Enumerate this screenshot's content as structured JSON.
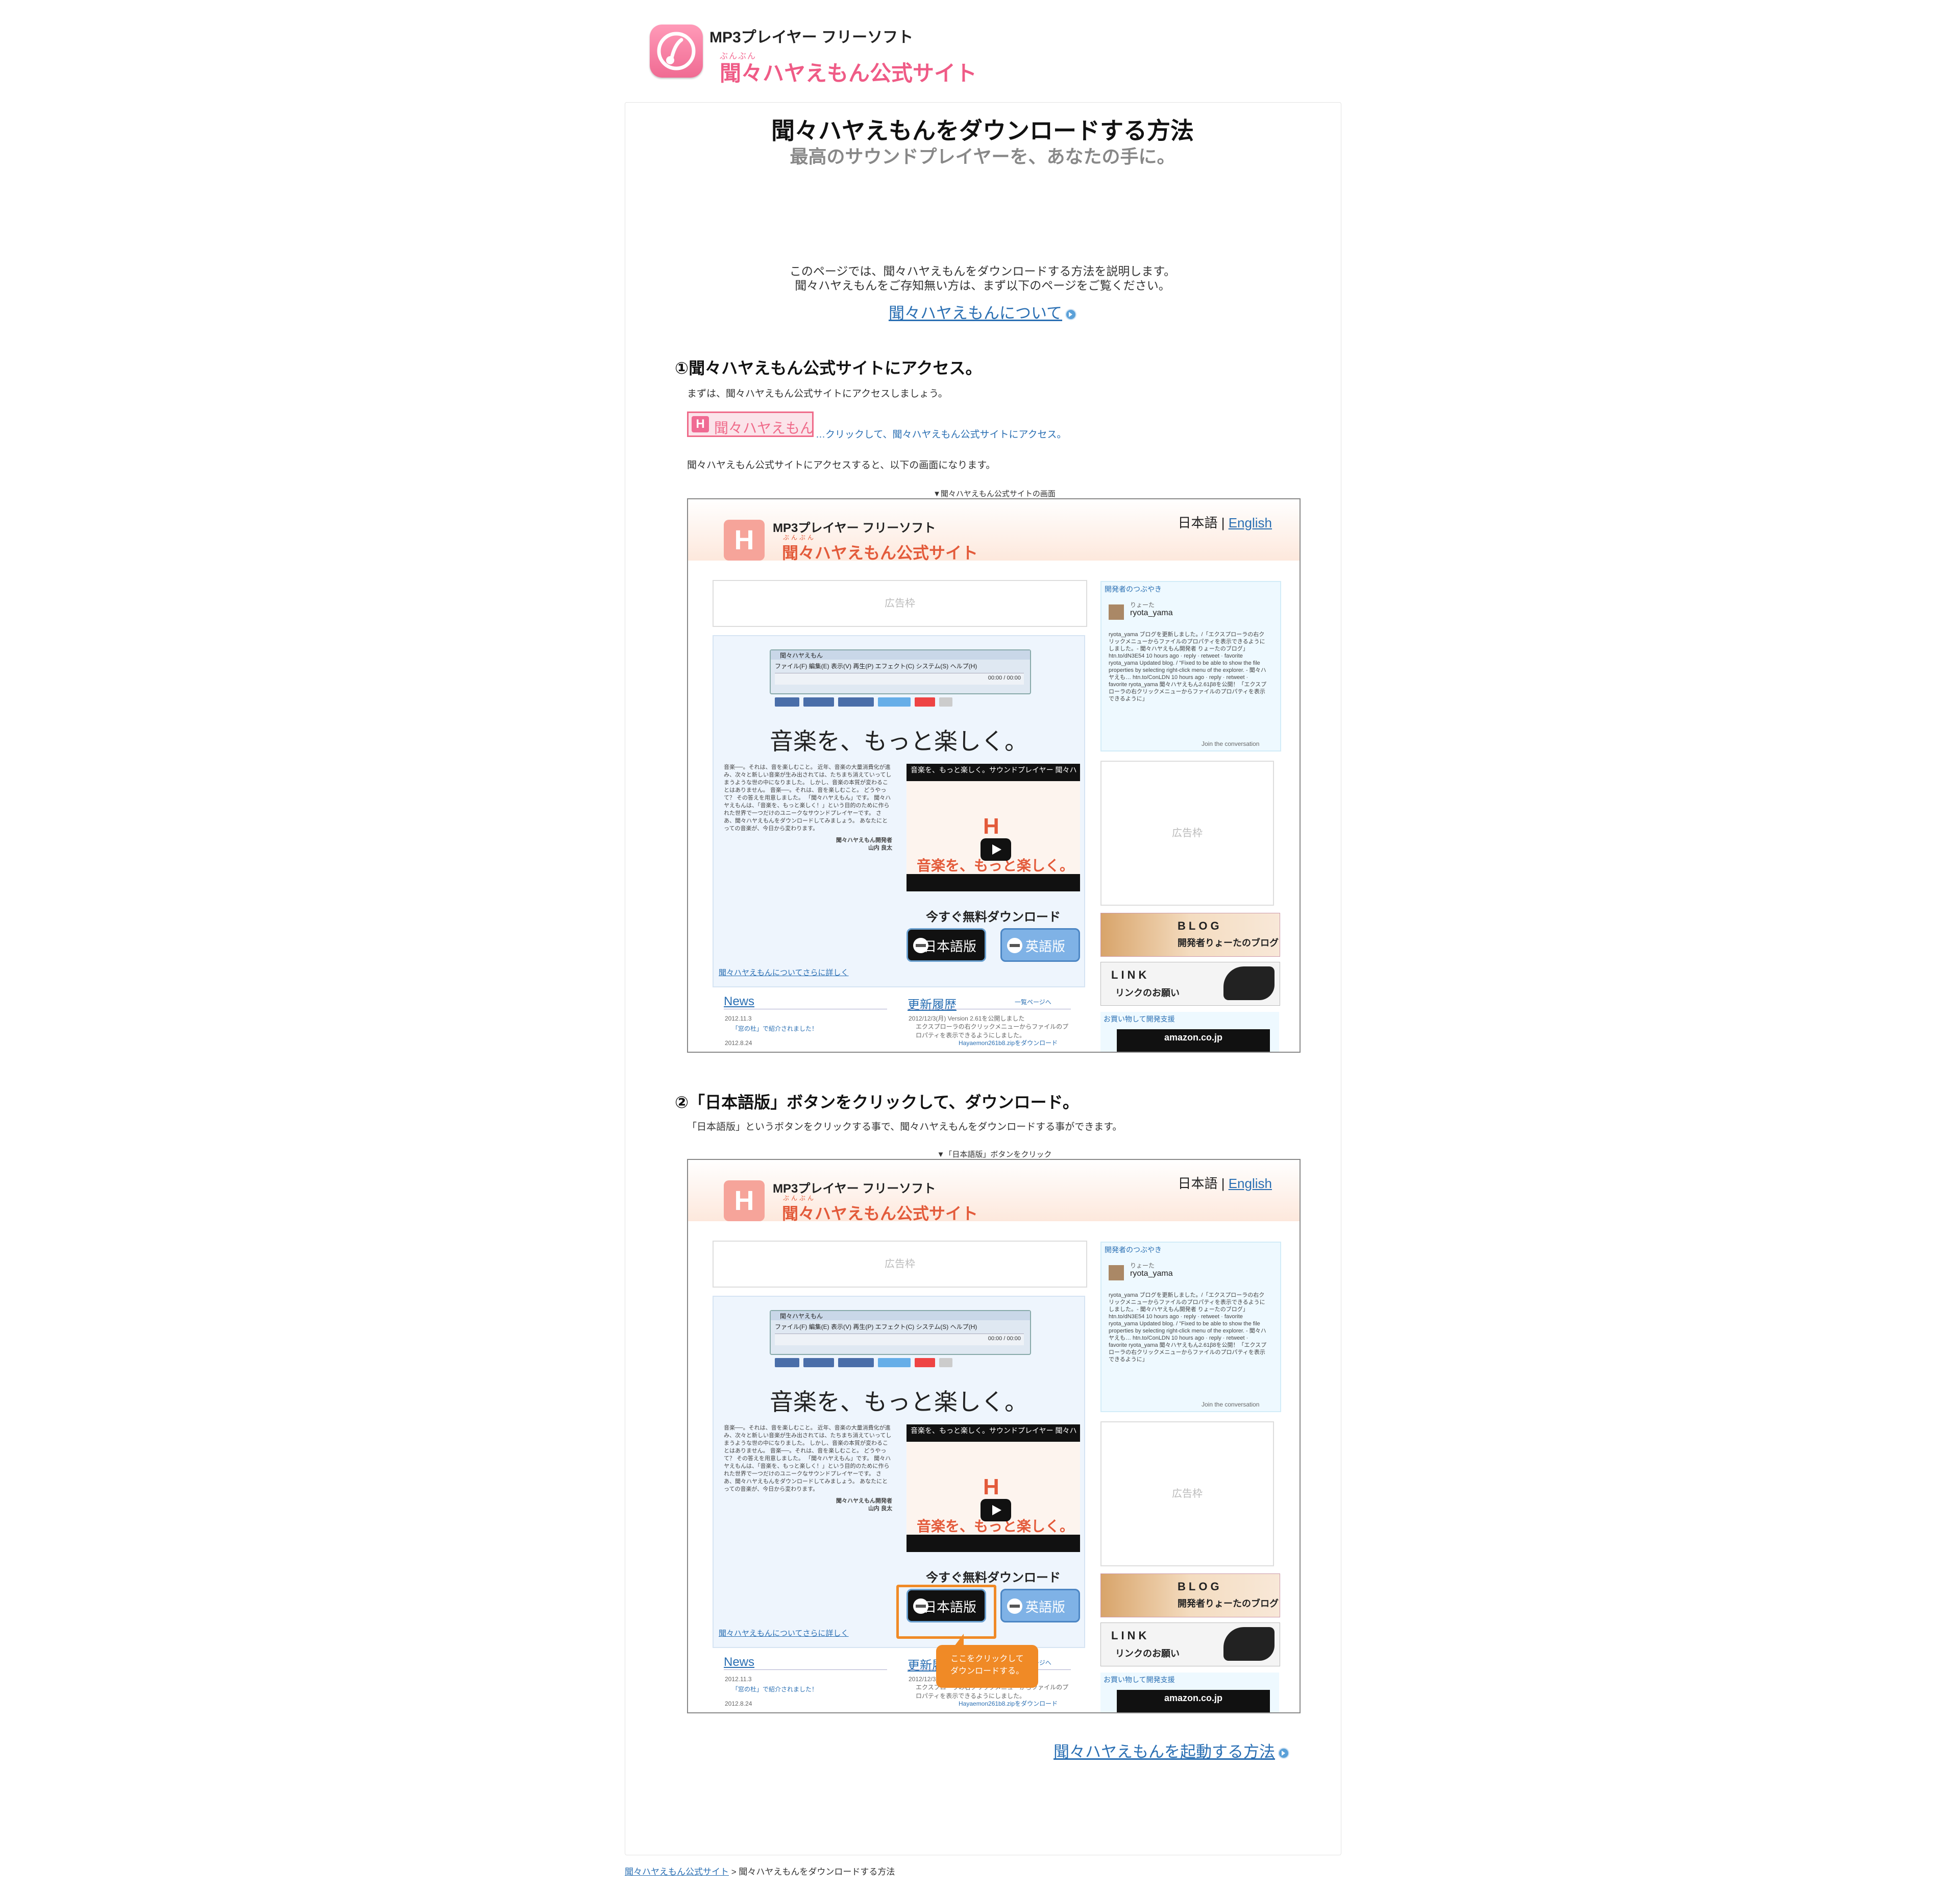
{
  "header": {
    "subtitle": "MP3プレイヤー フリーソフト",
    "ruby": "ぶんぶん",
    "title": "聞々ハヤえもん公式サイト"
  },
  "article": {
    "title": "聞々ハヤえもんをダウンロードする方法",
    "subtitle": "最高のサウンドプレイヤーを、あなたの手に。",
    "intro_line1": "このページでは、聞々ハヤえもんをダウンロードする方法を説明します。",
    "intro_line2": "聞々ハヤえもんをご存知無い方は、まず以下のページをご覧ください。",
    "about_link": "聞々ハヤえもんについて",
    "step1": {
      "heading": "①聞々ハヤえもん公式サイトにアクセス。",
      "text1": "まずは、聞々ハヤえもん公式サイトにアクセスしましょう。",
      "site_button_icon": "H",
      "site_button_label": "聞々ハヤえもん",
      "click_text": "…クリックして、聞々ハヤえもん公式サイトにアクセス。",
      "text2": "聞々ハヤえもん公式サイトにアクセスすると、以下の画面になります。",
      "caption": "▼聞々ハヤえもん公式サイトの画面"
    },
    "step2": {
      "heading": "②「日本語版」ボタンをクリックして、ダウンロード。",
      "text1": "「日本語版」というボタンをクリックする事で、聞々ハヤえもんをダウンロードする事ができます。",
      "caption": "▼「日本語版」ボタンをクリック",
      "callout_line1": "ここをクリックして",
      "callout_line2": "ダウンロードする。"
    },
    "next_link": "聞々ハヤえもんを起動する方法"
  },
  "screenshot": {
    "logo_letter": "H",
    "subtitle": "MP3プレイヤー フリーソフト",
    "ruby": "ぶんぶん",
    "title": "聞々ハヤえもん公式サイト",
    "lang_ja": "日本語",
    "lang_sep": "|",
    "lang_en": "English",
    "ad_label": "広告枠",
    "app_title": "聞々ハヤえもん",
    "app_menu": "ファイル(F)  編集(E)  表示(V)  再生(P)  エフェクト(C)  システム(S)  ヘルプ(H)",
    "app_time": "00:00 / 00:00",
    "big_slogan": "音楽を、もっと楽しく。",
    "body_text": "音楽──。それは、音を楽しむこと。 近年、音楽の大量消費化が進み、次々と新しい音楽が生み出されては、たちまち消えていってしまうような世の中になりました。 しかし、音楽の本質が変わることはありません。 音楽──。それは、音を楽しむこと。 どうやって？ その答えを用意しました。 「聞々ハヤえもん」です。 聞々ハヤえもんは、「音楽を、もっと楽しく！」という目的のために作られた世界で一つだけのユニークなサウンドプレイヤーです。 さあ、聞々ハヤえもんをダウンロードしてみましょう。 あなたにとっての音楽が、今日から変わります。",
    "author_line1": "聞々ハヤえもん開発者",
    "author_line2": "山内 良太",
    "video_title": "音楽を、もっと楽しく。サウンドプレイヤー 聞々ハ",
    "video_logo": "H",
    "video_slogan": "音楽を、もっと楽しく。",
    "download_heading": "今すぐ無料ダウンロード",
    "btn_ja": "日本語版",
    "btn_en": "英語版",
    "more_link": "聞々ハヤえもんについてさらに詳しく",
    "news_heading": "News",
    "news_date1": "2012.11.3",
    "news_item1": "「窓の杜」で紹介されました！",
    "news_date2": "2012.8.24",
    "updates_heading": "更新履歴",
    "updates_more": "一覧ページへ",
    "update_line1": "2012/12/3(月) Version 2.61を公開しました",
    "update_line2": "エクスプローラの右クリックメニューからファイルのプロパティを表示できるようにしました。",
    "update_download": "Hayaemon261b8.zipをダウンロード",
    "tweet_heading": "開発者のつぶやき",
    "tweet_user_kana": "りょーた",
    "tweet_user": "ryota_yama",
    "tweet_text": "ryota_yama ブログを更新しました。/「エクスプローラの右クリックメニューからファイルのプロパティを表示できるようにしました。- 聞々ハヤえもん開発者 りょーたのブログ」 htn.to/dN3E54 10 hours ago · reply · retweet · favorite ryota_yama Updated blog. / \"Fixed to be able to show the file properties by selecting right-click menu of the explorer. - 聞々ハヤえも… htn.to/ConLDN 10 hours ago · reply · retweet · favorite ryota_yama 聞々ハヤえもん2.61β8を公開！「エクスプローラの右クリックメニューからファイルのプロパティを表示できるように」",
    "tweet_join": "Join the conversation",
    "blog_title": "BLOG",
    "blog_sub": "開発者りょーたのブログ",
    "link_title": "LINK",
    "link_sub": "リンクのお願い",
    "amazon_heading": "お買い物して開発支援",
    "amazon_label": "amazon.co.jp"
  },
  "breadcrumb": {
    "home": "聞々ハヤえもん公式サイト",
    "sep": " > ",
    "current": "聞々ハヤえもんをダウンロードする方法"
  },
  "colors": {
    "brand_pink": "#ef5b86",
    "link_blue": "#2a6fb3",
    "highlight_orange": "#f08a26"
  }
}
